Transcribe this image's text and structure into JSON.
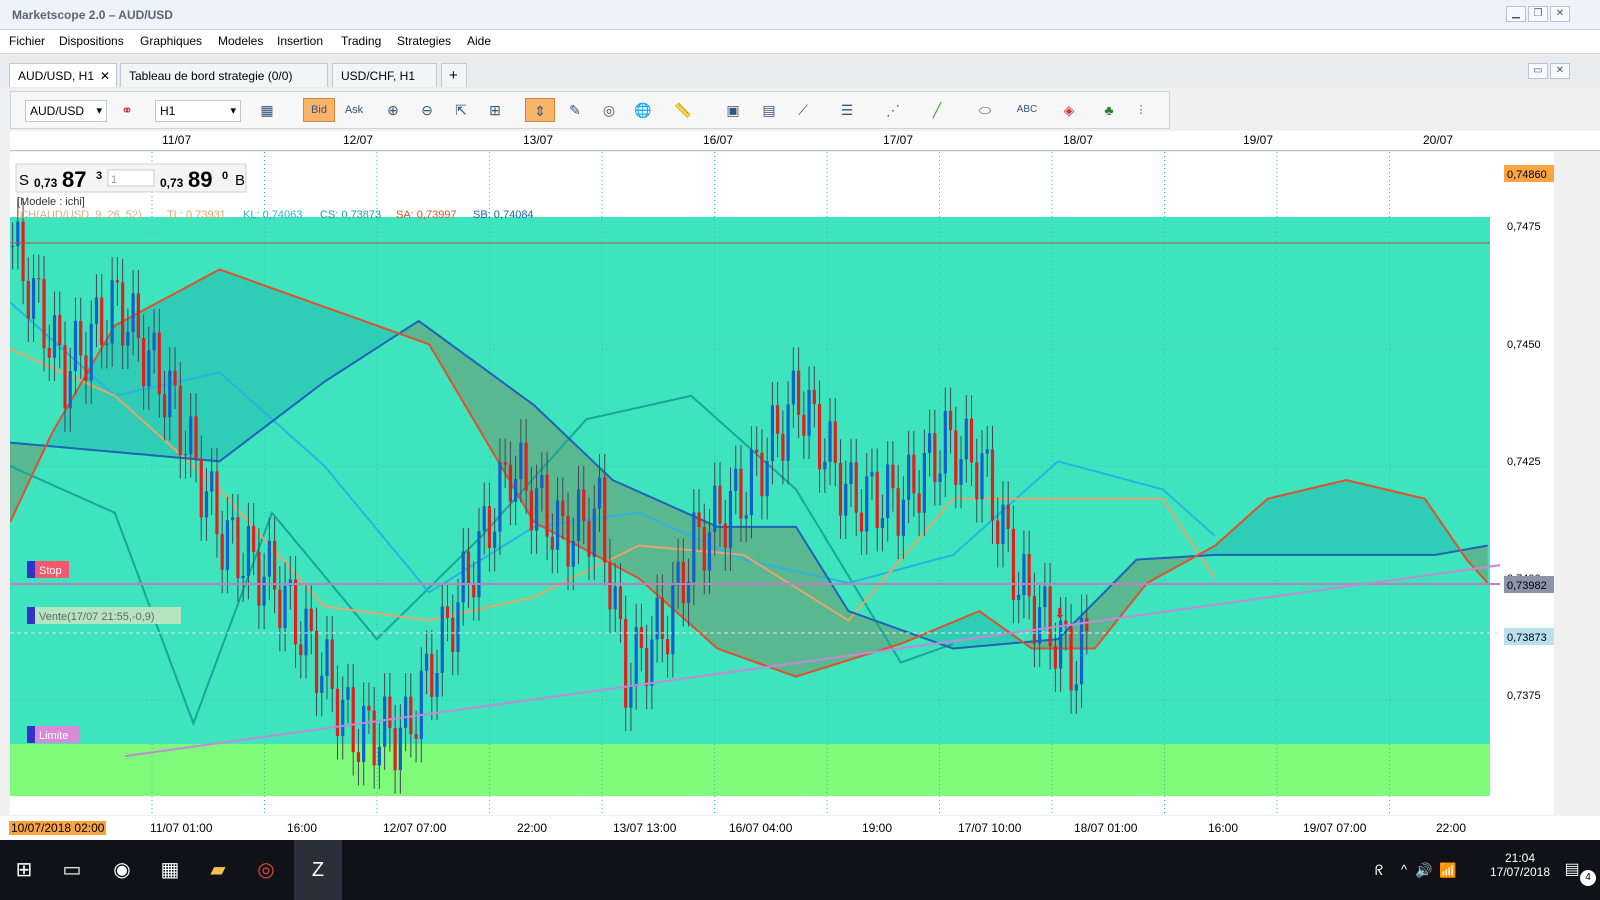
{
  "window": {
    "title": "Marketscope 2.0 – AUD/USD"
  },
  "menu": [
    "Fichier",
    "Dispositions",
    "Graphiques",
    "Modeles",
    "Insertion",
    "Trading",
    "Strategies",
    "Aide"
  ],
  "tabs": [
    {
      "label": "AUD/USD, H1",
      "close": "✕"
    },
    {
      "label": "Tableau de bord strategie (0/0)"
    },
    {
      "label": "USD/CHF, H1"
    }
  ],
  "tab_add": "+",
  "toolbar": {
    "symbol": "AUD/USD",
    "timeframe": "H1",
    "bid": "Bid",
    "ask": "Ask"
  },
  "quote": {
    "sell_label": "S",
    "sell_prefix": "0,73",
    "sell_big": "87",
    "sell_sup": "3",
    "amount": "1",
    "buy_prefix": "0,73",
    "buy_big": "89",
    "buy_sup": "0",
    "buy_label": "B"
  },
  "legend": {
    "model": "[Modele : ichi]",
    "indicator": "ICH(AUD/USD, 9, 26, 52)",
    "tl": "TL: 0,73931",
    "kl": "KL: 0,74063",
    "cs": "CS: 0,73873",
    "sa": "SA: 0,73997",
    "sb": "SB: 0,74084"
  },
  "orders": {
    "stop": "Stop",
    "sell": "Vente(17/07 21:55,-0,9)",
    "limit": "Limite"
  },
  "price_axis": {
    "ticks": [
      "0,7475",
      "0,7450",
      "0,7425",
      "0,7400",
      "0,7375"
    ],
    "current": "0,74860",
    "line1": "0,73982",
    "line2": "0,73873"
  },
  "date_ticks": [
    "11/07",
    "12/07",
    "13/07",
    "16/07",
    "17/07",
    "18/07",
    "19/07",
    "20/07"
  ],
  "time_axis": {
    "start": "10/07/2018 02:00",
    "ticks": [
      "11/07 01:00",
      "16:00",
      "12/07 07:00",
      "22:00",
      "13/07 13:00",
      "16/07 04:00",
      "19:00",
      "17/07 10:00",
      "18/07 01:00",
      "16:00",
      "19/07 07:00",
      "22:00"
    ]
  },
  "taskbar": {
    "time": "21:04",
    "date": "17/07/2018",
    "badge": "4"
  },
  "colors": {
    "bg": "#3de4bd",
    "upper_zone": "#38e2c0",
    "lower_zone": "#7ffa7a",
    "cloud_bull": "#2ec9b5",
    "cloud_bear": "#5fb08a",
    "tenkan": "#e6a56a",
    "kijun": "#2ab3e0",
    "span_a": "#e0502a",
    "span_b": "#1e63b8",
    "chikou": "#1aa59a",
    "trend": "#c08ad8",
    "hline": "#c080c0",
    "bull_candle": "#1460c4",
    "bear_candle": "#e02020"
  },
  "chart_data": {
    "type": "candlestick",
    "x_range": [
      "10/07/2018 02:00",
      "20/07/2018 22:00"
    ],
    "ylim": [
      0.7363,
      0.7489
    ],
    "candles_hint": "hourly AUD/USD bars",
    "key_levels": [
      0.7486,
      0.73982,
      0.73873
    ],
    "span_a": [
      [
        0,
        0.7413
      ],
      [
        8,
        0.7432
      ],
      [
        20,
        0.7455
      ],
      [
        40,
        0.7467
      ],
      [
        60,
        0.7459
      ],
      [
        80,
        0.7451
      ],
      [
        100,
        0.7413
      ],
      [
        120,
        0.7401
      ],
      [
        135,
        0.7386
      ],
      [
        150,
        0.738
      ],
      [
        170,
        0.7387
      ],
      [
        185,
        0.7394
      ],
      [
        195,
        0.7386
      ],
      [
        207,
        0.7386
      ],
      [
        217,
        0.74
      ],
      [
        230,
        0.7408
      ],
      [
        240,
        0.7418
      ],
      [
        255,
        0.7422
      ],
      [
        270,
        0.7418
      ],
      [
        278,
        0.7405
      ],
      [
        282,
        0.74
      ]
    ],
    "span_b": [
      [
        0,
        0.743
      ],
      [
        40,
        0.7426
      ],
      [
        60,
        0.7443
      ],
      [
        78,
        0.7456
      ],
      [
        100,
        0.7438
      ],
      [
        115,
        0.7422
      ],
      [
        135,
        0.7412
      ],
      [
        150,
        0.7412
      ],
      [
        160,
        0.7394
      ],
      [
        180,
        0.7386
      ],
      [
        200,
        0.7388
      ],
      [
        215,
        0.7405
      ],
      [
        230,
        0.7406
      ],
      [
        272,
        0.7406
      ],
      [
        282,
        0.7408
      ]
    ],
    "tenkan": [
      [
        0,
        0.745
      ],
      [
        20,
        0.744
      ],
      [
        40,
        0.742
      ],
      [
        60,
        0.7395
      ],
      [
        80,
        0.7392
      ],
      [
        100,
        0.7397
      ],
      [
        120,
        0.7408
      ],
      [
        140,
        0.7406
      ],
      [
        160,
        0.7392
      ],
      [
        180,
        0.7418
      ],
      [
        200,
        0.7418
      ],
      [
        220,
        0.7418
      ],
      [
        230,
        0.7401
      ]
    ],
    "kijun": [
      [
        0,
        0.746
      ],
      [
        20,
        0.744
      ],
      [
        40,
        0.7445
      ],
      [
        60,
        0.7425
      ],
      [
        80,
        0.7398
      ],
      [
        100,
        0.7412
      ],
      [
        120,
        0.7415
      ],
      [
        140,
        0.7405
      ],
      [
        160,
        0.74
      ],
      [
        180,
        0.7406
      ],
      [
        200,
        0.7426
      ],
      [
        220,
        0.742
      ],
      [
        230,
        0.741
      ]
    ],
    "chikou": [
      [
        0,
        0.7425
      ],
      [
        20,
        0.7415
      ],
      [
        35,
        0.737
      ],
      [
        50,
        0.7415
      ],
      [
        70,
        0.7388
      ],
      [
        90,
        0.741
      ],
      [
        110,
        0.7435
      ],
      [
        130,
        0.744
      ],
      [
        150,
        0.742
      ],
      [
        170,
        0.7383
      ],
      [
        180,
        0.7387
      ]
    ],
    "trendline": [
      [
        22,
        0.7363
      ],
      [
        292,
        0.7405
      ]
    ]
  }
}
